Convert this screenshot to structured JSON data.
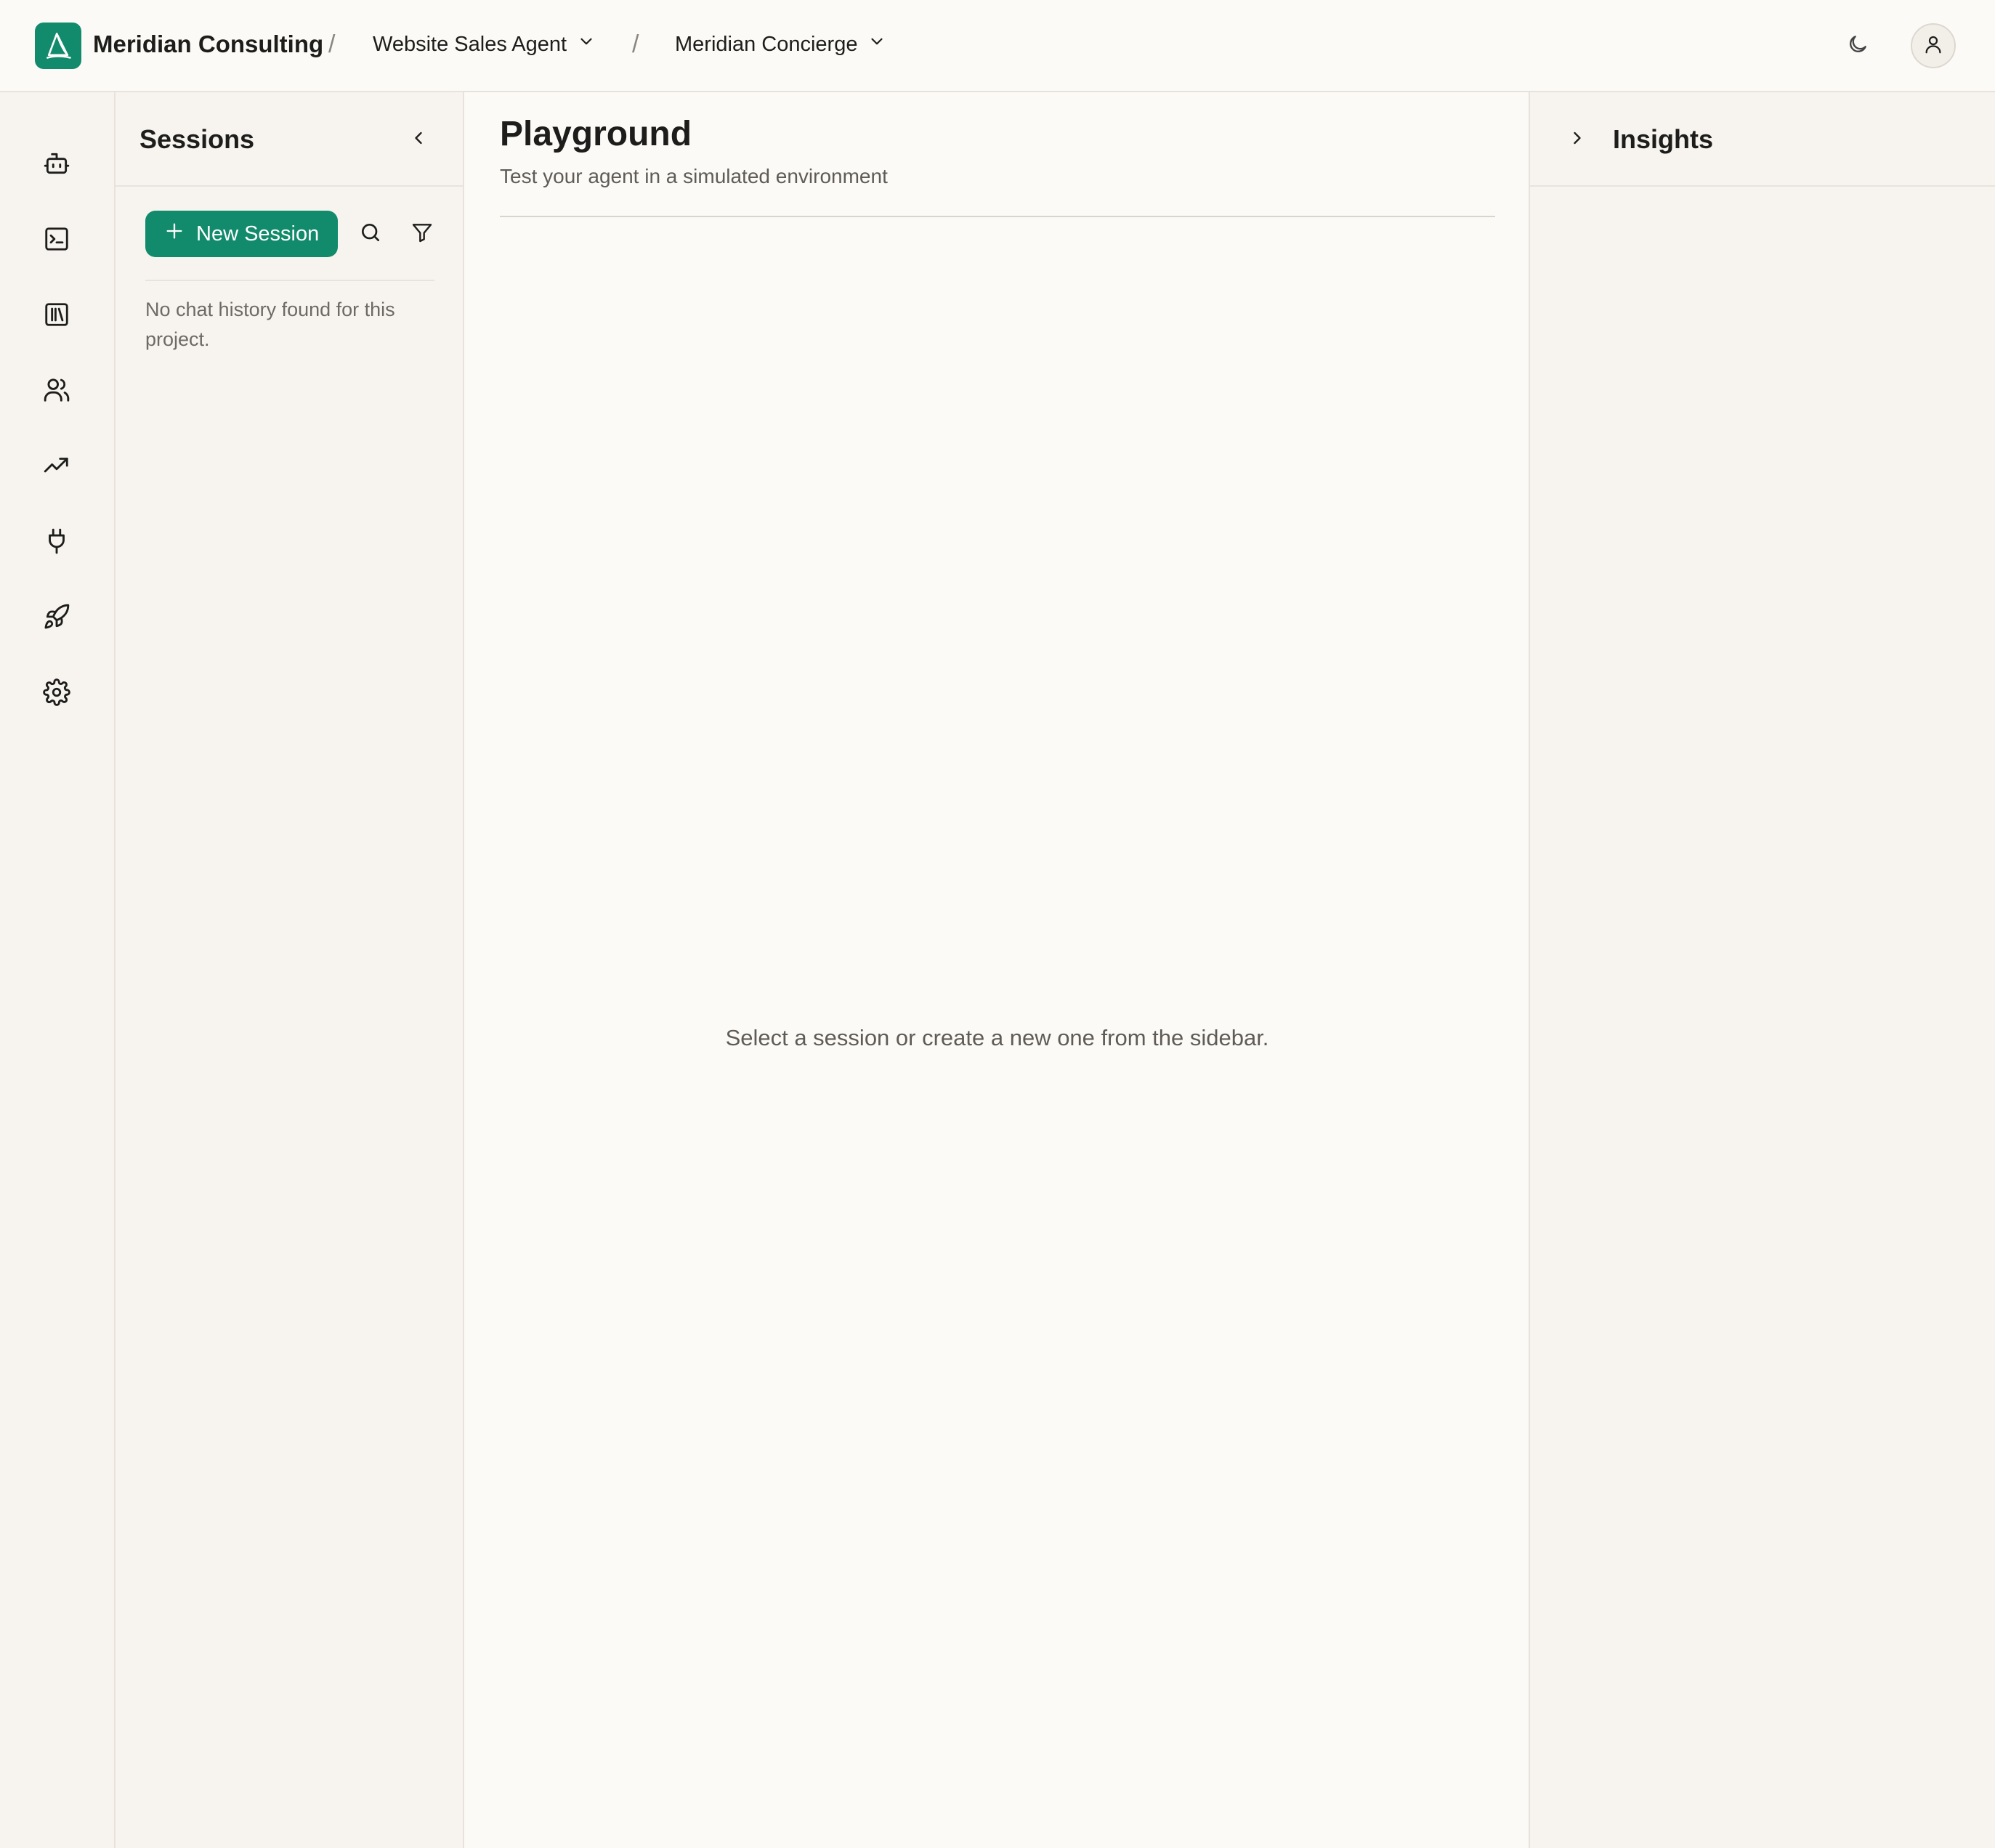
{
  "header": {
    "brand": "Meridian Consulting",
    "separator": "/",
    "agent_selector": "Website Sales Agent",
    "project_selector": "Meridian Concierge",
    "icons": [
      "sailboat-logo-icon",
      "chevron-down-icon",
      "moon-icon",
      "user-icon"
    ]
  },
  "leftnav": {
    "items": [
      {
        "icon": "bot-icon"
      },
      {
        "icon": "terminal-icon"
      },
      {
        "icon": "library-icon"
      },
      {
        "icon": "users-icon"
      },
      {
        "icon": "trending-up-icon"
      },
      {
        "icon": "plug-icon"
      },
      {
        "icon": "rocket-icon"
      },
      {
        "icon": "gear-icon"
      }
    ]
  },
  "sessions": {
    "title": "Sessions",
    "new_session_label": "New Session",
    "empty_text": "No chat history found for this project."
  },
  "main": {
    "title": "Playground",
    "subtitle": "Test your agent in a simulated environment",
    "empty_state": "Select a session or create a new one from the sidebar."
  },
  "insights": {
    "title": "Insights"
  },
  "colors": {
    "accent": "#128a6c",
    "background": "#fcfaf6",
    "panel": "#f7f4ef",
    "border": "#e7e3dc",
    "muted_text": "#6d6a65"
  }
}
